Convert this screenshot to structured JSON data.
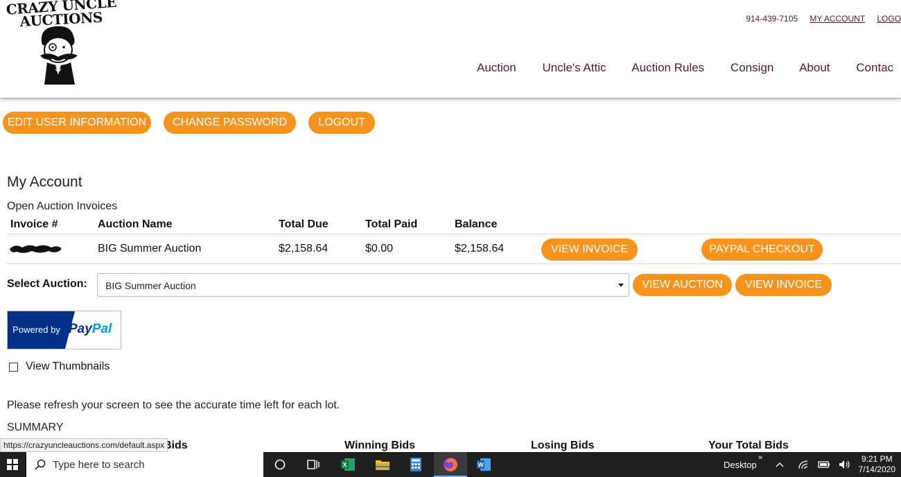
{
  "header": {
    "logo_line1": "CRAZY UNCLE",
    "logo_line2": "AUCTIONS",
    "phone": "914-439-7105",
    "my_account": "MY ACCOUNT",
    "logout_link": "LOGO",
    "nav": [
      "Auction",
      "Uncle's Attic",
      "Auction Rules",
      "Consign",
      "About",
      "Contac"
    ]
  },
  "account_buttons": {
    "edit_user": "EDIT USER INFORMATION",
    "change_password": "CHANGE PASSWORD",
    "logout": "LOGOUT"
  },
  "page_title": "My Account",
  "invoices": {
    "section_title": "Open Auction Invoices",
    "columns": [
      "Invoice #",
      "Auction Name",
      "Total Due",
      "Total Paid",
      "Balance"
    ],
    "rows": [
      {
        "invoice_no": "",
        "auction_name": "BIG Summer Auction",
        "total_due": "$2,158.64",
        "total_paid": "$0.00",
        "balance": "$2,158.64",
        "view_invoice": "VIEW INVOICE",
        "paypal_checkout": "PAYPAL CHECKOUT"
      }
    ]
  },
  "select_auction": {
    "label": "Select Auction:",
    "selected": "BIG Summer Auction",
    "view_auction": "VIEW AUCTION",
    "view_invoice": "VIEW INVOICE"
  },
  "paypal_badge": {
    "powered_by": "Powered by",
    "pay": "Pay",
    "pal": "Pal"
  },
  "thumbnails": {
    "label": "View Thumbnails",
    "checked": false
  },
  "refresh_note": "Please refresh your screen to see the accurate time left for each lot.",
  "summary": {
    "title": "SUMMARY",
    "columns": [
      "Bids",
      "Winning Bids",
      "Losing Bids",
      "Your Total Bids"
    ]
  },
  "status_bar_url": "https://crazyuncleauctions.com/default.aspx",
  "taskbar": {
    "search_placeholder": "Type here to search",
    "desktop_label": "Desktop",
    "time": "9:21 PM",
    "date": "7/14/2020"
  },
  "colors": {
    "accent_orange": "#f7941d",
    "nav_text": "#4a1c3b",
    "paypal_dark": "#003087",
    "paypal_light": "#009cde"
  }
}
